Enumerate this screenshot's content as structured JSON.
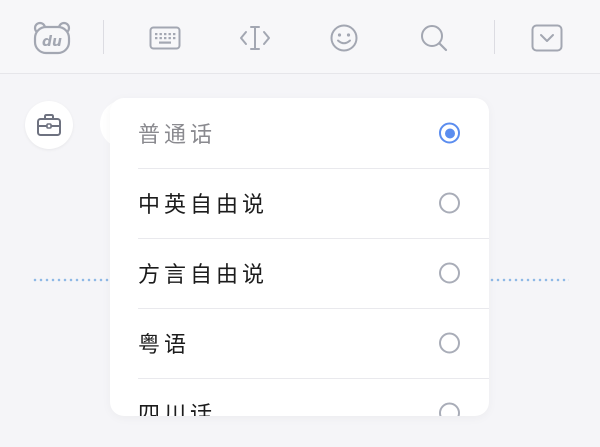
{
  "toolbar": {
    "logo_text": "du",
    "icons": [
      "du-bear-logo-icon",
      "keyboard-icon",
      "cursor-move-icon",
      "emoji-icon",
      "search-icon",
      "collapse-chevron-icon"
    ]
  },
  "voice_input": {
    "options": [
      {
        "label": "普通话",
        "selected": true
      },
      {
        "label": "中英自由说",
        "selected": false
      },
      {
        "label": "方言自由说",
        "selected": false
      },
      {
        "label": "粤语",
        "selected": false
      },
      {
        "label": "四川话",
        "selected": false
      }
    ]
  },
  "colors": {
    "accent": "#5b8def",
    "radio_border": "#a9adb8",
    "icon_gray": "#a3a7b2",
    "selected_text": "#8a8a8f",
    "text": "#1c1c1c",
    "background": "#f5f5f8"
  }
}
